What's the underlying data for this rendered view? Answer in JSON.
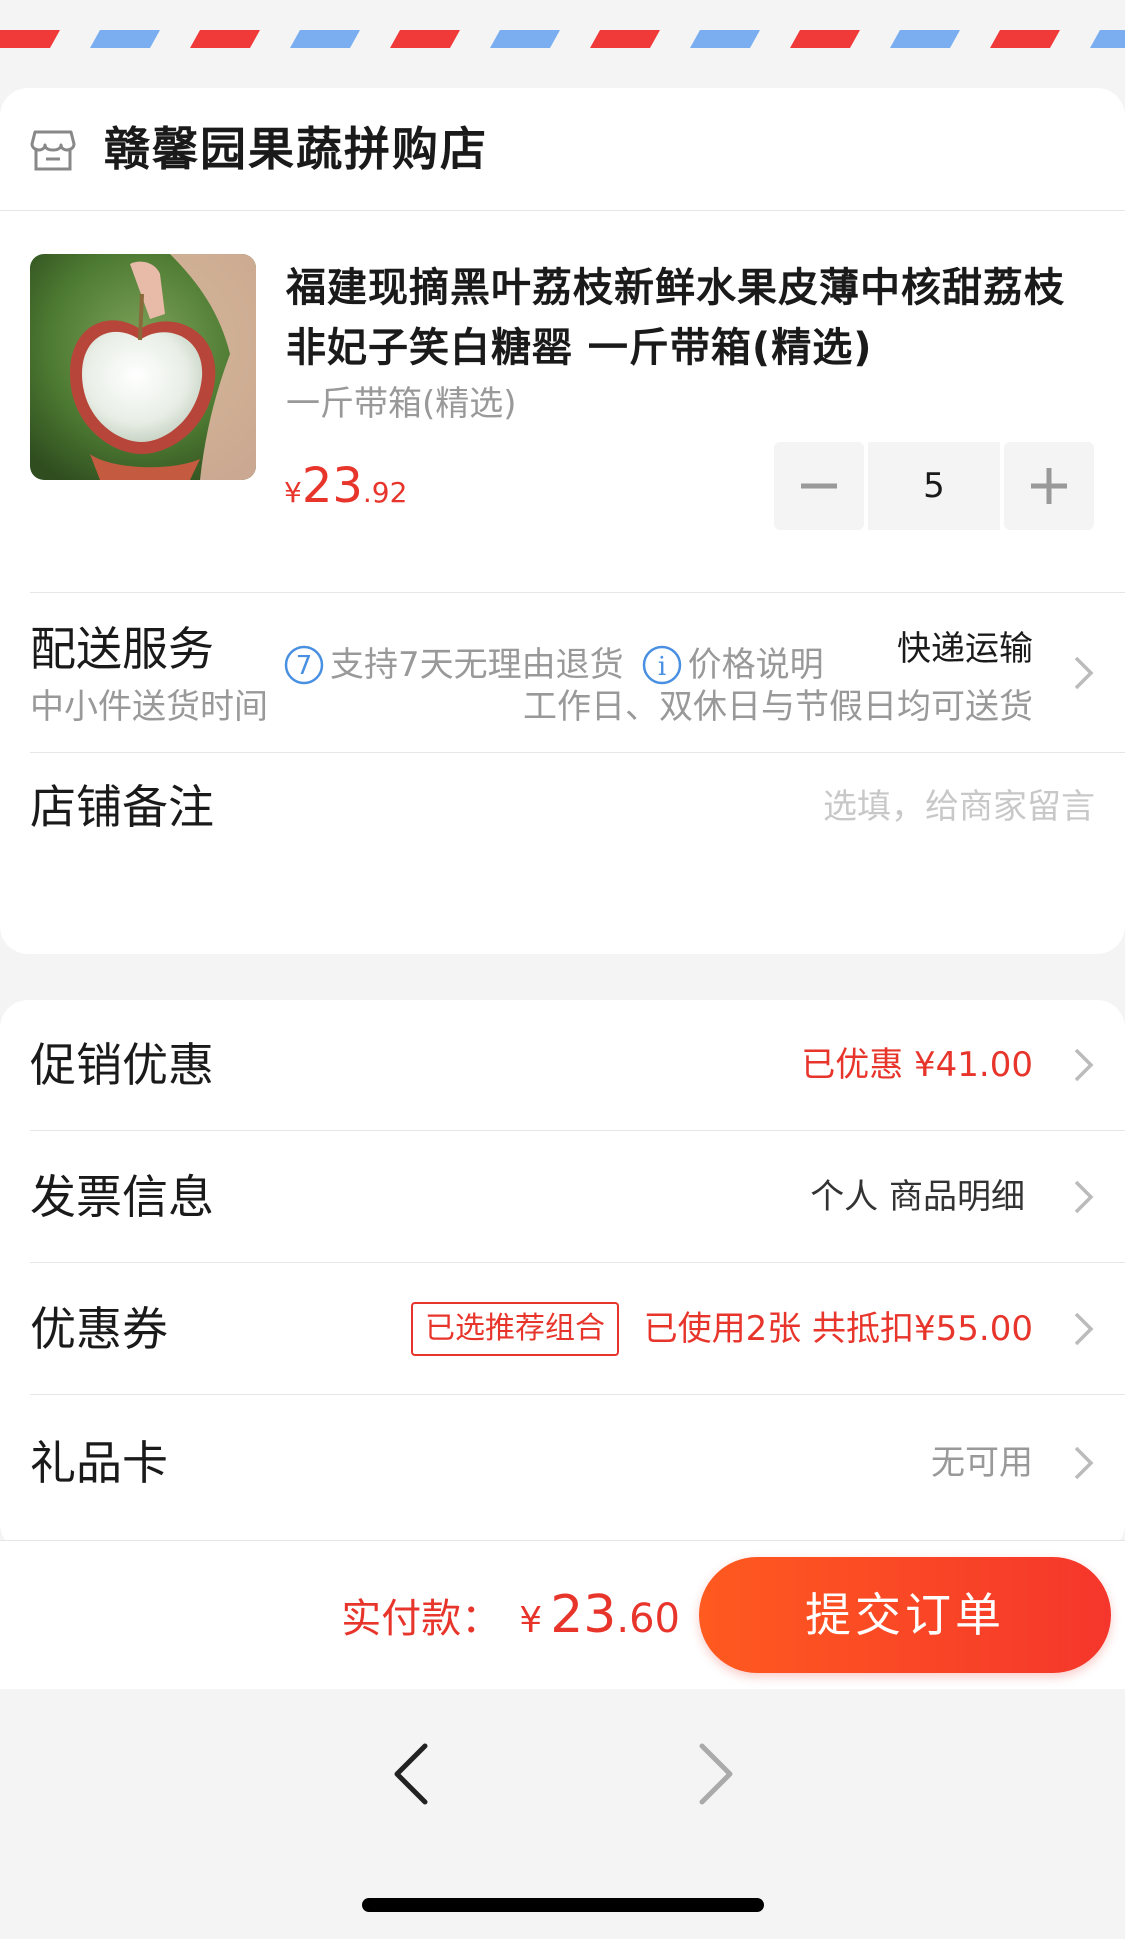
{
  "shop": {
    "name": "赣馨园果蔬拼购店",
    "icon": "store-icon"
  },
  "product": {
    "title": "福建现摘黑叶荔枝新鲜水果皮薄中核甜荔枝非妃子笑白糖罂 一斤带箱(精选)",
    "spec": "一斤带箱(精选)",
    "price_currency": "¥",
    "price_int": "23",
    "price_dec": ".92",
    "quantity": "5",
    "tags": [
      {
        "icon": "seven-day-return-icon",
        "glyph": "7",
        "label": "支持7天无理由退货"
      },
      {
        "icon": "info-icon",
        "glyph": "i",
        "label": "价格说明"
      }
    ]
  },
  "delivery": {
    "title": "配送服务",
    "value": "快递运输",
    "sub_label": "中小件送货时间",
    "sub_value": "工作日、双休日与节假日均可送货"
  },
  "note": {
    "title": "店铺备注",
    "placeholder": "选填，给商家留言"
  },
  "promotion": {
    "title": "促销优惠",
    "value": "已优惠 ¥41.00"
  },
  "invoice": {
    "title": "发票信息",
    "value": "个人 商品明细"
  },
  "coupon": {
    "title": "优惠券",
    "badge": "已选推荐组合",
    "value": "已使用2张 共抵扣¥55.00"
  },
  "giftcard": {
    "title": "礼品卡",
    "value": "无可用"
  },
  "bottom": {
    "pay_label": "实付款：",
    "pay_currency": "¥",
    "pay_int": "23",
    "pay_dec": ".60",
    "submit_label": "提交订单"
  },
  "colors": {
    "accent_red": "#e8352c",
    "button_gradient_start": "#ff5a1f",
    "button_gradient_end": "#f5362c",
    "airmail_red": "#f03a3a",
    "airmail_blue": "#7aaef0",
    "tag_blue": "#4a90e2"
  }
}
